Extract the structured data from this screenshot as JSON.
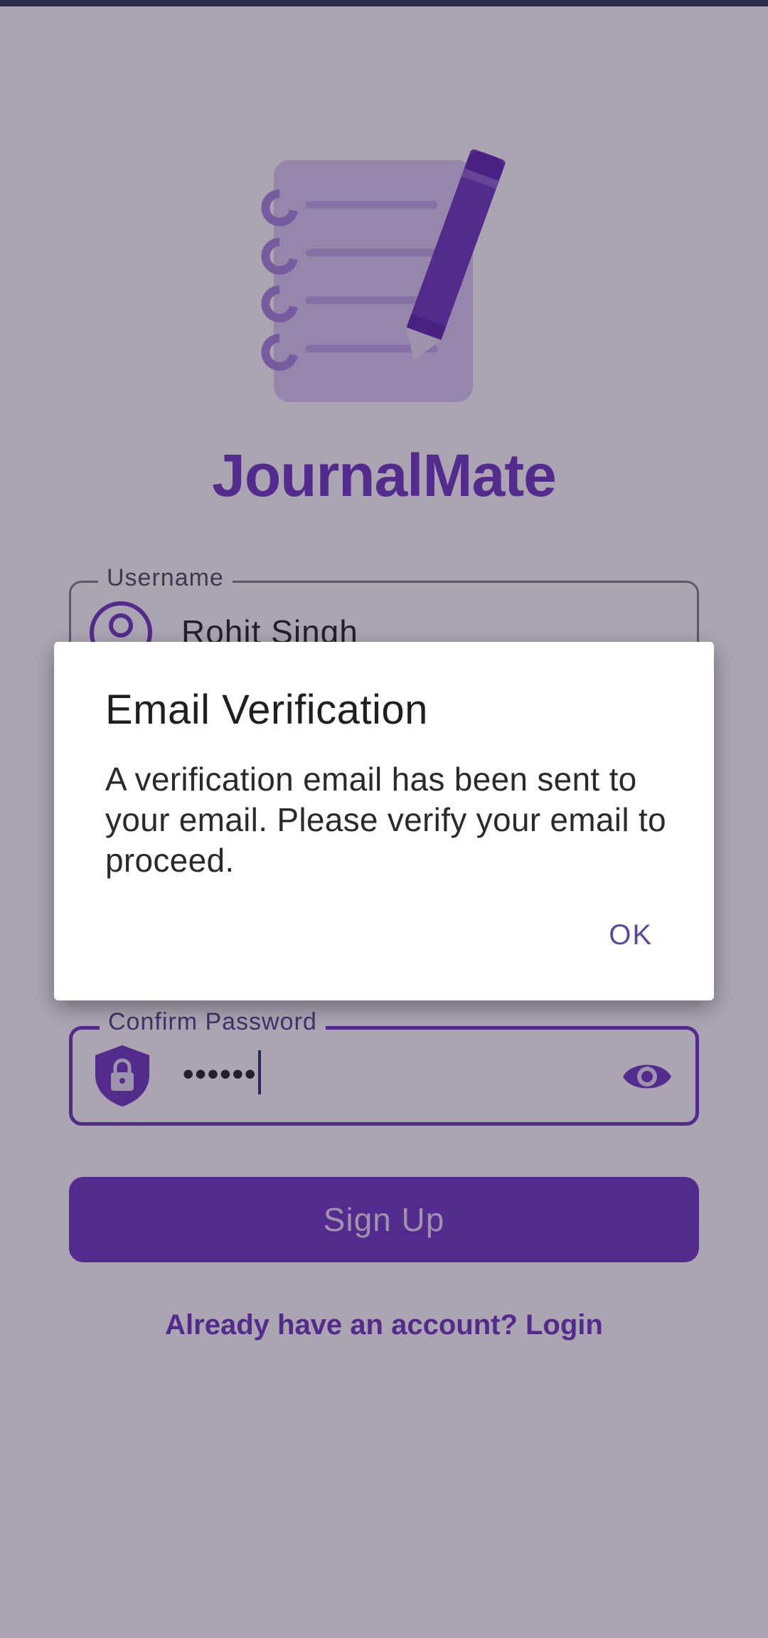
{
  "app": {
    "title": "JournalMate"
  },
  "form": {
    "username": {
      "label": "Username",
      "value": "Rohit Singh"
    },
    "confirm_password": {
      "label": "Confirm Password",
      "value": "••••••"
    },
    "signup_label": "Sign Up",
    "login_link": "Already have an account? Login"
  },
  "dialog": {
    "title": "Email Verification",
    "message": "A verification email has been sent to your email. Please verify your email to proceed.",
    "ok_label": "OK"
  },
  "icons": {
    "logo": "notebook-pen-icon",
    "username": "account-circle-icon",
    "password": "lock-shield-icon",
    "visibility": "eye-icon"
  },
  "colors": {
    "primary": "#6b2fc1",
    "scrim": "rgba(48,38,62,0.40)",
    "dialog_background": "#ffffff"
  }
}
